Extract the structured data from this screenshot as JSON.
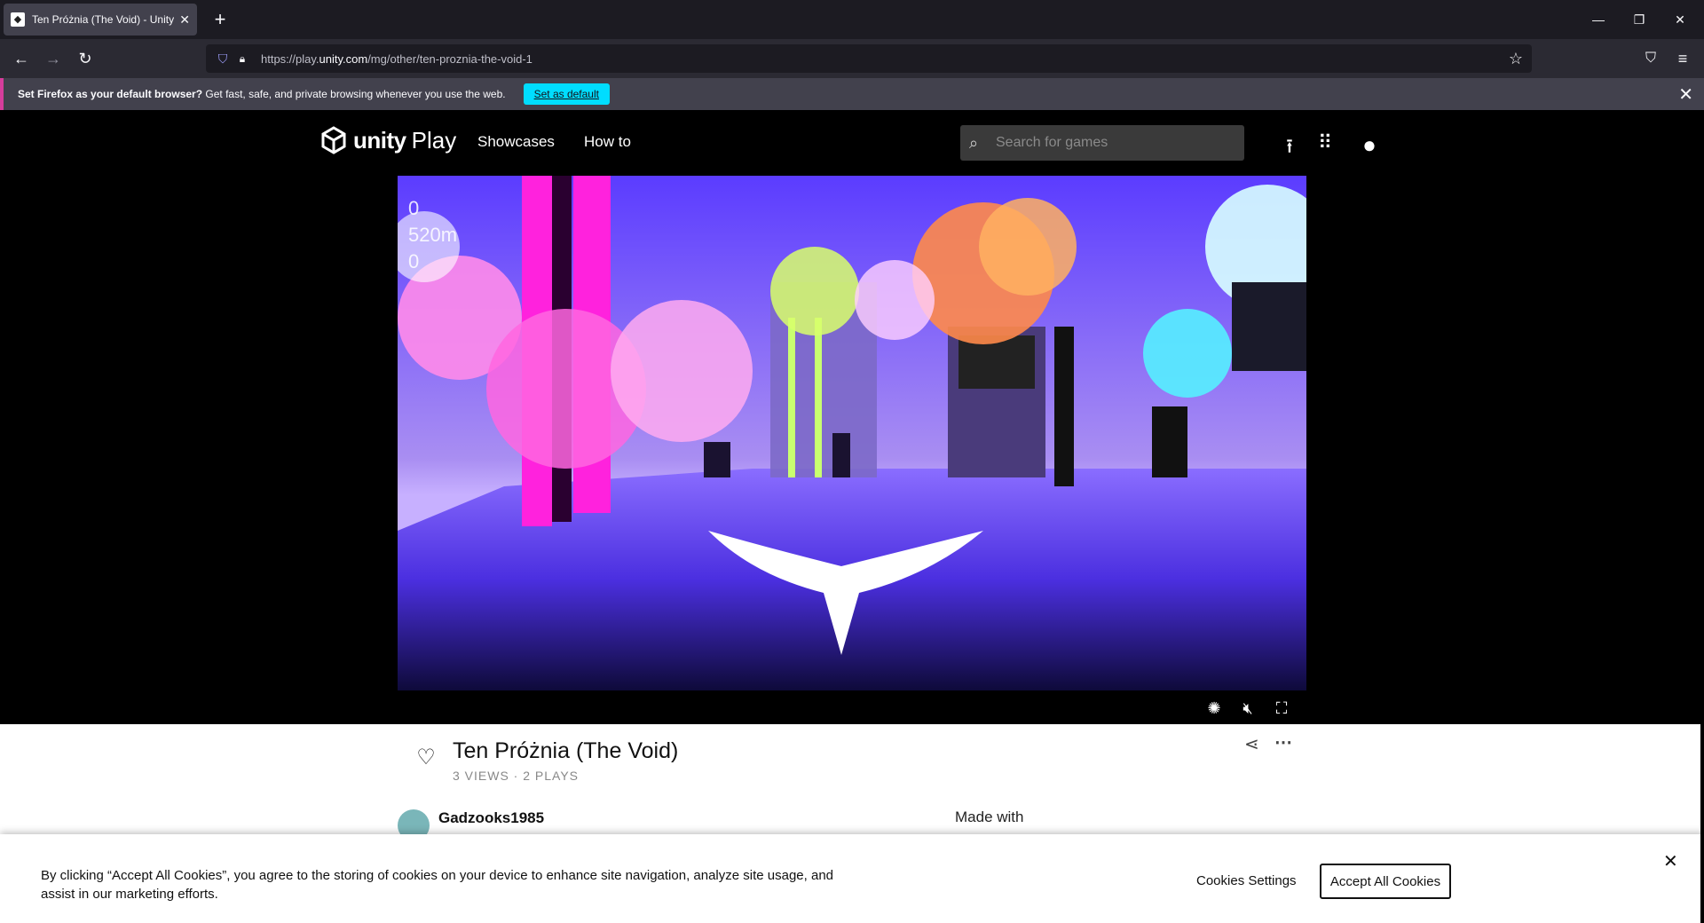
{
  "browser": {
    "tab_title": "Ten Próżnia (The Void) - Unity P",
    "url_prefix": "https://play.",
    "url_host": "unity.com",
    "url_path": "/mg/other/ten-proznia-the-void-1",
    "notification": {
      "bold": "Set Firefox as your default browser?",
      "text": " Get fast, safe, and private browsing whenever you use the web.",
      "button": "Set as default"
    }
  },
  "header": {
    "logo_word": "unity",
    "logo_suffix": "Play",
    "nav": [
      "Showcases",
      "How to"
    ],
    "search_placeholder": "Search for games"
  },
  "game": {
    "hud": [
      "0",
      "520m",
      "0"
    ],
    "title": "Ten Próżnia (The Void)",
    "stats": "3 VIEWS · 2 PLAYS",
    "author": "Gadzooks1985",
    "made_with": "Made with"
  },
  "cookie": {
    "text": "By clicking “Accept All Cookies”, you agree to the storing of cookies on your device to enhance site navigation, analyze site usage, and assist in our marketing efforts.",
    "settings": "Cookies Settings",
    "accept": "Accept All Cookies"
  },
  "icons": {
    "accent_notification": "#d63d9c",
    "set_default_button": "#00ddff"
  }
}
